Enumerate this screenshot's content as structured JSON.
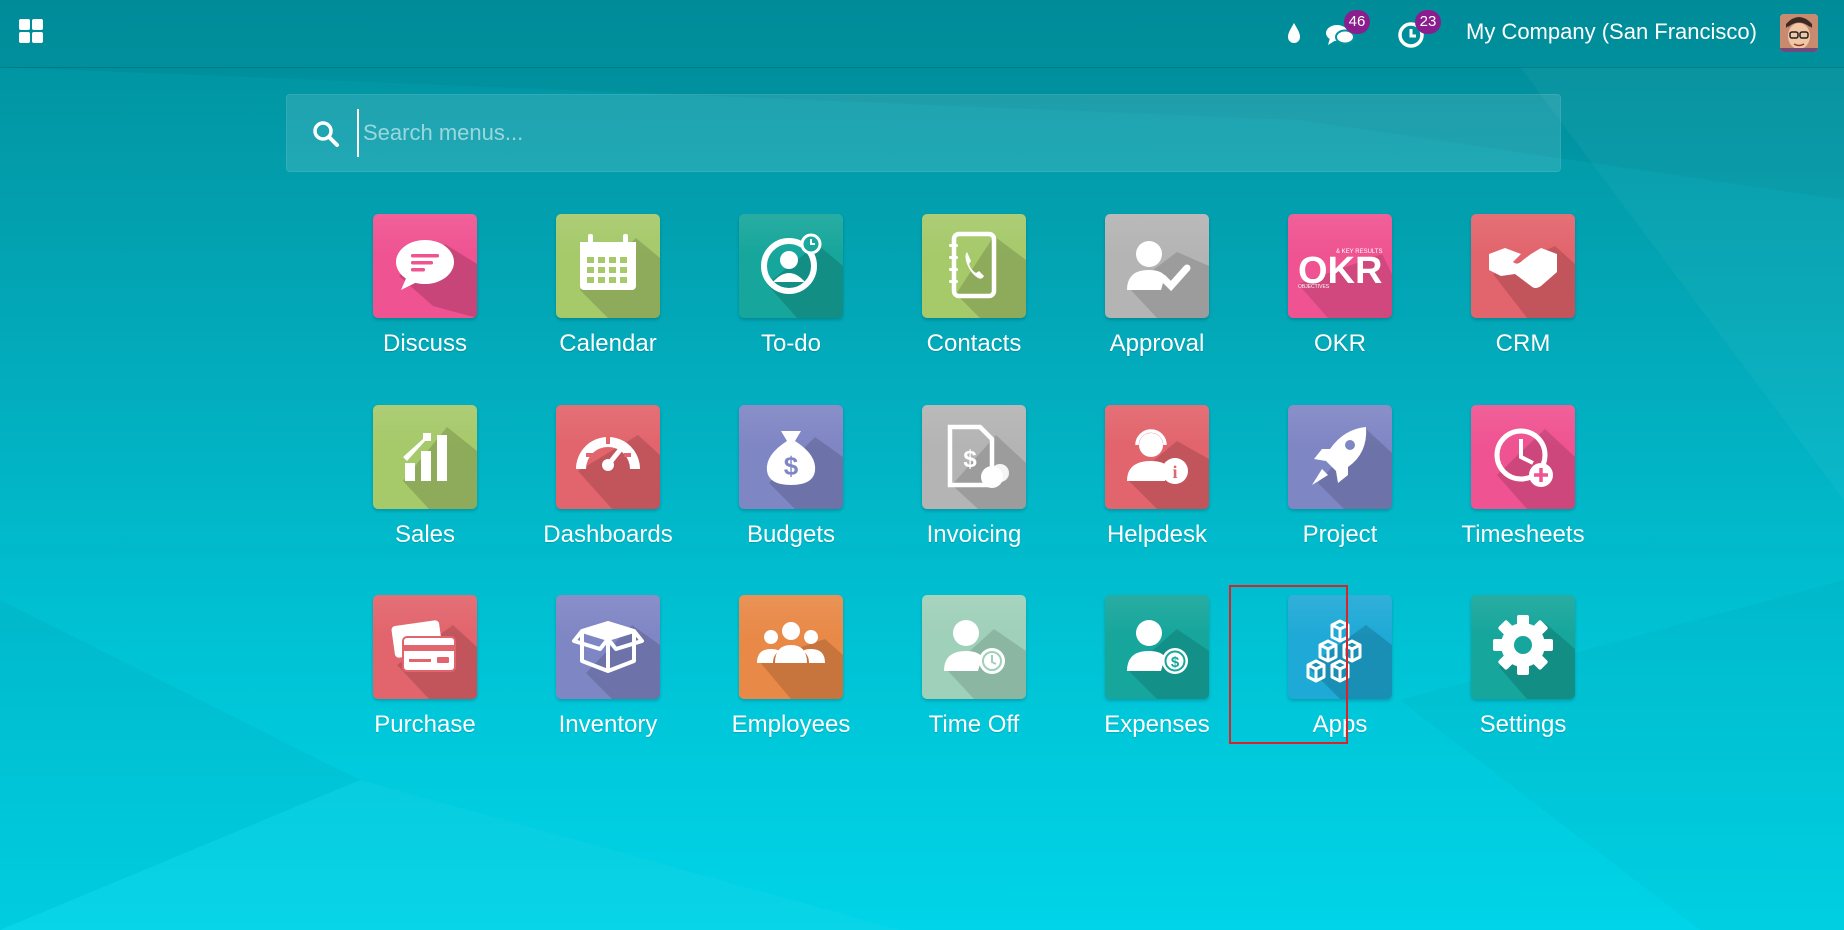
{
  "topbar": {
    "menu_icon": "app-grid-icon",
    "system_icons": [
      {
        "name": "debug-drop-icon"
      },
      {
        "name": "messages-icon",
        "count": "46"
      },
      {
        "name": "activities-icon",
        "count": "23"
      }
    ],
    "company": "My Company (San Francisco)",
    "avatar": "user-avatar"
  },
  "search": {
    "placeholder": "Search menus...",
    "value": ""
  },
  "apps": [
    {
      "label": "Discuss",
      "color": "#ef5391",
      "icon": "chat-bubble-icon"
    },
    {
      "label": "Calendar",
      "color": "#a6c96a",
      "icon": "calendar-icon"
    },
    {
      "label": "To-do",
      "color": "#16a69b",
      "icon": "todo-icon"
    },
    {
      "label": "Contacts",
      "color": "#a6c96a",
      "icon": "phone-book-icon"
    },
    {
      "label": "Approval",
      "color": "#b4b4b4",
      "icon": "user-check-icon"
    },
    {
      "label": "OKR",
      "color": "#ef5391",
      "icon": "okr-icon"
    },
    {
      "label": "CRM",
      "color": "#e2646c",
      "icon": "handshake-icon"
    },
    {
      "label": "Sales",
      "color": "#a6c96a",
      "icon": "growth-chart-icon"
    },
    {
      "label": "Dashboards",
      "color": "#e2646c",
      "icon": "speedometer-icon"
    },
    {
      "label": "Budgets",
      "color": "#7f86c4",
      "icon": "money-bag-icon"
    },
    {
      "label": "Invoicing",
      "color": "#b4b4b4",
      "icon": "invoice-icon"
    },
    {
      "label": "Helpdesk",
      "color": "#e2646c",
      "icon": "headset-info-icon"
    },
    {
      "label": "Project",
      "color": "#7f86c4",
      "icon": "rocket-icon"
    },
    {
      "label": "Timesheets",
      "color": "#ef5391",
      "icon": "clock-plus-icon"
    },
    {
      "label": "Purchase",
      "color": "#e2646c",
      "icon": "credit-cards-icon"
    },
    {
      "label": "Inventory",
      "color": "#7f86c4",
      "icon": "open-box-icon"
    },
    {
      "label": "Employees",
      "color": "#e88948",
      "icon": "people-group-icon"
    },
    {
      "label": "Time Off",
      "color": "#9fd0b9",
      "icon": "user-clock-icon"
    },
    {
      "label": "Expenses",
      "color": "#16a69b",
      "icon": "user-dollar-icon"
    },
    {
      "label": "Apps",
      "color": "#1fa9d6",
      "icon": "cubes-icon"
    },
    {
      "label": "Settings",
      "color": "#16a69b",
      "icon": "gear-icon"
    }
  ]
}
